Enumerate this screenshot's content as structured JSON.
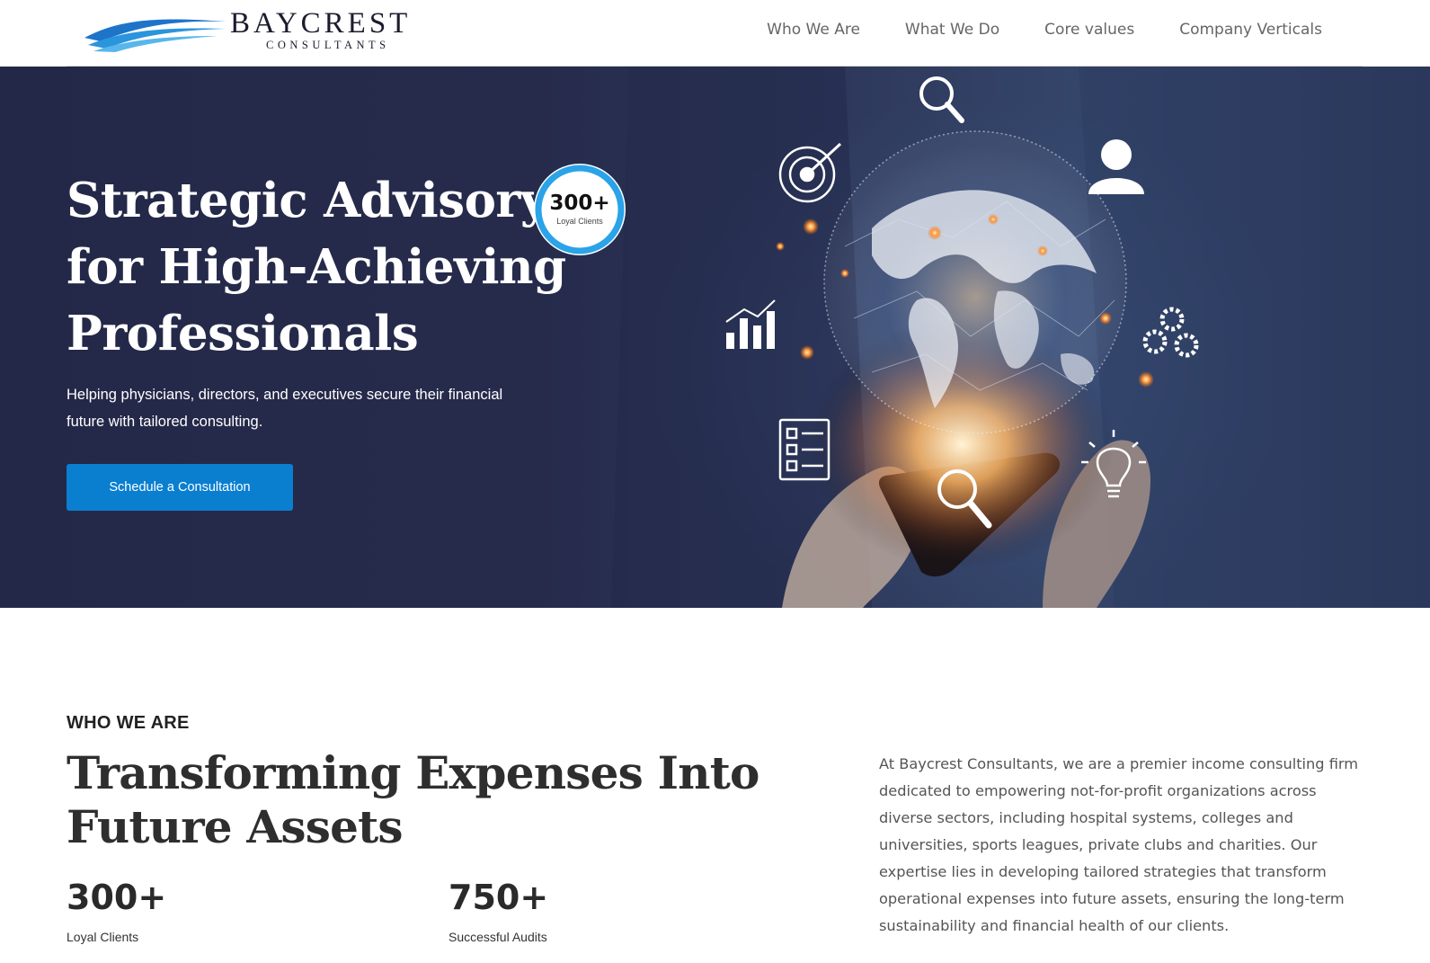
{
  "header": {
    "logo_title": "BAYCREST",
    "logo_subtitle": "CONSULTANTS",
    "nav": [
      "Who We Are",
      "What We Do",
      "Core values",
      "Company Verticals"
    ]
  },
  "hero": {
    "title_lines": [
      "Strategic Advisory",
      "for High-Achieving",
      "Professionals"
    ],
    "subtitle": "Helping physicians, directors, and executives secure their financial future with tailored consulting.",
    "cta_label": "Schedule a Consultation",
    "badge": {
      "value": "300+",
      "label": "Loyal Clients",
      "ring_color": "#2aa3e8"
    },
    "icons": [
      "magnifier-icon",
      "target-icon",
      "user-icon",
      "bar-chart-icon",
      "gears-icon",
      "checklist-icon",
      "magnifier-icon",
      "lightbulb-icon",
      "globe-network",
      "smartphone"
    ]
  },
  "who": {
    "eyebrow": "WHO WE ARE",
    "title_lines": [
      "Transforming Expenses Into",
      "Future Assets"
    ],
    "stats": [
      {
        "value": "300+",
        "label": "Loyal Clients"
      },
      {
        "value": "750+",
        "label": "Successful Audits"
      }
    ],
    "body": "At Baycrest Consultants, we are a premier income consulting firm dedicated to empowering not-for-profit organizations across diverse sectors, including hospital systems, colleges and universities, sports leagues, private clubs and charities. Our expertise lies in developing tailored strategies that transform operational expenses into future assets, ensuring the long-term sustainability and financial health of our clients."
  },
  "colors": {
    "accent": "#0a7fd0",
    "hero_bg": "#262b4c",
    "heading": "#2e2e2e",
    "nav_text": "#666666"
  }
}
